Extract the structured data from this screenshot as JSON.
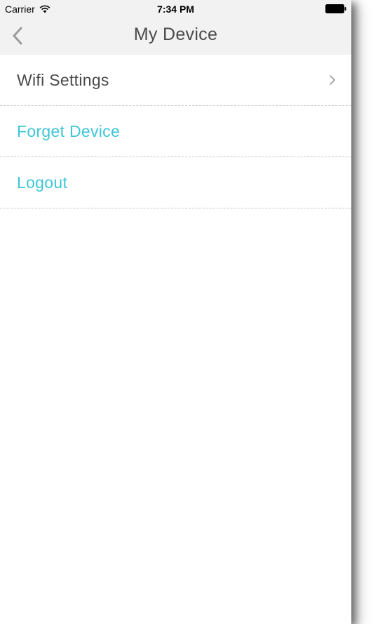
{
  "status_bar": {
    "carrier": "Carrier",
    "time": "7:34 PM",
    "wifi_icon": "wifi-icon",
    "battery_icon": "battery-icon"
  },
  "nav": {
    "title": "My Device",
    "back_icon": "chevron-left-icon"
  },
  "menu": {
    "wifi_settings": "Wifi Settings",
    "forget_device": "Forget Device",
    "logout": "Logout"
  },
  "colors": {
    "accent": "#3ec6d6",
    "text_dark": "#4a4a4a",
    "bar_background": "#f2f2f2",
    "divider": "#c9c9c9",
    "icon_gray": "#9b9b9b"
  }
}
